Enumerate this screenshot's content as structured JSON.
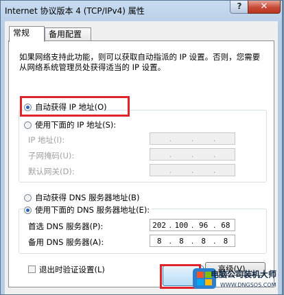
{
  "window": {
    "title": "Internet 协议版本 4 (TCP/IPv4) 属性",
    "help_label": "?",
    "close_label": "✕"
  },
  "tabs": [
    {
      "label": "常规",
      "active": true
    },
    {
      "label": "备用配置",
      "active": false
    }
  ],
  "description": "如果网络支持此功能，则可以获取自动指派的 IP 设置。否则，您需要从网络系统管理员处获得适当的 IP 设置。",
  "ip_mode": {
    "auto_label": "自动获得 IP 地址(O)",
    "manual_label": "使用下面的 IP 地址(S):",
    "selected": "auto"
  },
  "ip_fields": [
    {
      "label": "IP 地址(I):",
      "value": [
        "",
        "",
        "",
        ""
      ]
    },
    {
      "label": "子网掩码(U):",
      "value": [
        "",
        "",
        "",
        ""
      ]
    },
    {
      "label": "默认网关(D):",
      "value": [
        "",
        "",
        "",
        ""
      ]
    }
  ],
  "dns_mode": {
    "auto_label": "自动获得 DNS 服务器地址(B)",
    "manual_label": "使用下面的 DNS 服务器地址(E):",
    "selected": "manual"
  },
  "dns_fields": [
    {
      "label": "首选 DNS 服务器(P):",
      "value": [
        "202",
        "100",
        "96",
        "68"
      ]
    },
    {
      "label": "备用 DNS 服务器(A):",
      "value": [
        "8",
        "8",
        "8",
        "8"
      ]
    }
  ],
  "validate_on_exit_label": "退出时验证设置(L)",
  "advanced_label": "高级(V)...",
  "watermark": {
    "title": "电脑公司装机大师",
    "url": "WWW.DNGSOS.COM"
  },
  "colors": {
    "highlight": "#e0232b",
    "radio_dot": "#2a62b8"
  }
}
